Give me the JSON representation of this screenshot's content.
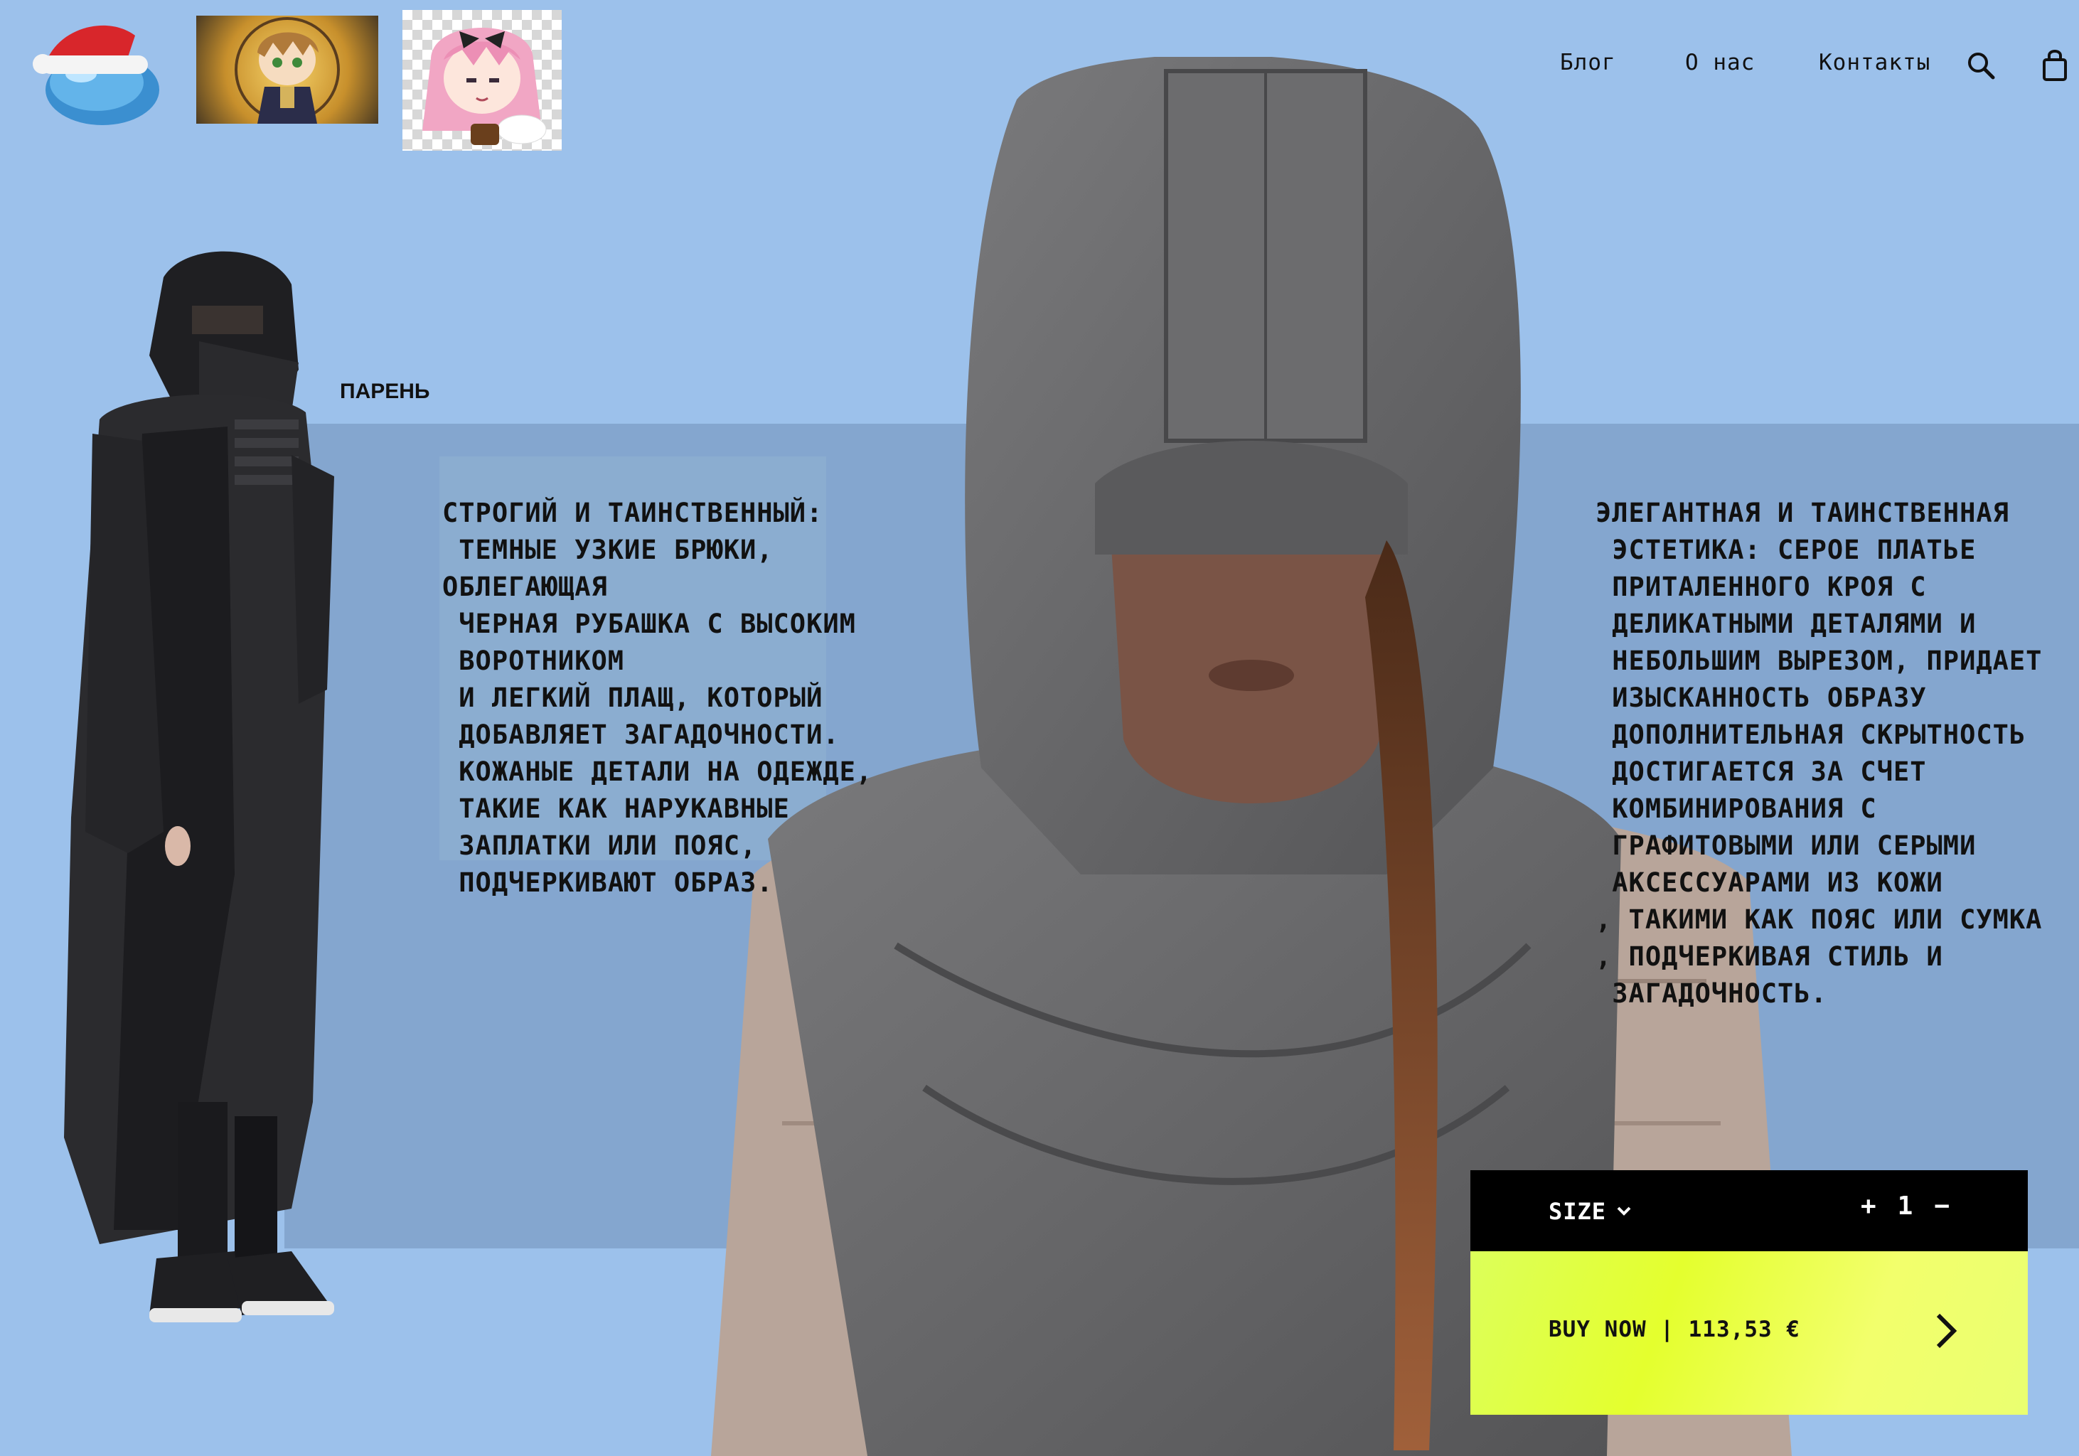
{
  "nav": {
    "blog": "Блог",
    "about": "О нас",
    "contacts": "Контакты"
  },
  "icons": {
    "logo": "slime-santa-hat-logo",
    "avatar_1": "anime-boy-avatar",
    "avatar_2": "anime-girl-avatar",
    "search": "search-icon",
    "bag": "shopping-bag-icon"
  },
  "male_section": {
    "label": "ПАРЕНЬ",
    "description": "СТРОГИЙ И ТАИНСТВЕННЫЙ:\n ТЕМНЫЕ УЗКИЕ БРЮКИ,\nОБЛЕГАЮЩАЯ\n ЧЕРНАЯ РУБАШКА С ВЫСОКИМ\n ВОРОТНИКОМ\n И ЛЕГКИЙ ПЛАЩ, КОТОРЫЙ\n ДОБАВЛЯЕТ ЗАГАДОЧНОСТИ.\n КОЖАНЫЕ ДЕТАЛИ НА ОДЕЖДЕ,\n ТАКИЕ КАК НАРУКАВНЫЕ\n ЗАПЛАТКИ ИЛИ ПОЯС,\n ПОДЧЕРКИВАЮТ ОБРАЗ."
  },
  "female_section": {
    "description": "ЭЛЕГАНТНАЯ И ТАИНСТВЕННАЯ\n ЭСТЕТИКА: СЕРОЕ ПЛАТЬЕ\n ПРИТАЛЕННОГО КРОЯ С\n ДЕЛИКАТНЫМИ ДЕТАЛЯМИ И\n НЕБОЛЬШИМ ВЫРЕЗОМ, ПРИДАЕТ\n ИЗЫСКАННОСТЬ ОБРАЗУ\n ДОПОЛНИТЕЛЬНАЯ СКРЫТНОСТЬ\n ДОСТИГАЕТСЯ ЗА СЧЕТ\n КОМБИНИРОВАНИЯ С\n ГРАФИТОВЫМИ ИЛИ СЕРЫМИ\n АКСЕССУАРАМИ ИЗ КОЖИ\n, ТАКИМИ КАК ПОЯС ИЛИ СУМКА\n, ПОДЧЕРКИВАЯ СТИЛЬ И\n ЗАГАДОЧНОСТЬ."
  },
  "purchase": {
    "size_label": "SIZE",
    "plus": "+",
    "quantity": "1",
    "minus": "−",
    "buy_label": "BUY NOW | 113,53 €"
  },
  "colors": {
    "background": "#9cc1eb",
    "band": "#84a6cf",
    "size_bar": "#000000",
    "buy_bar": "#e4ff2e"
  }
}
